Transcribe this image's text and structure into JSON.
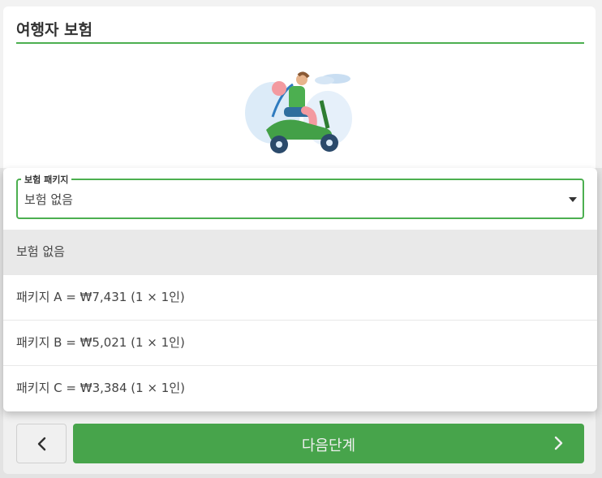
{
  "page": {
    "title": "여행자 보험"
  },
  "insurance": {
    "field_label": "보험 패키지",
    "selected_value": "보험 없음",
    "options": [
      {
        "label": "보험 없음",
        "selected": true
      },
      {
        "label": "패키지 A = ₩7,431 (1 × 1인)",
        "selected": false
      },
      {
        "label": "패키지 B = ₩5,021 (1 × 1인)",
        "selected": false
      },
      {
        "label": "패키지 C = ₩3,384 (1 × 1인)",
        "selected": false
      }
    ]
  },
  "footer": {
    "back_icon": "chevron-left-icon",
    "next_label": "다음단계",
    "next_icon": "chevron-right-icon"
  },
  "colors": {
    "accent": "#4caf50",
    "selected_option_bg": "#e9e9e9"
  }
}
